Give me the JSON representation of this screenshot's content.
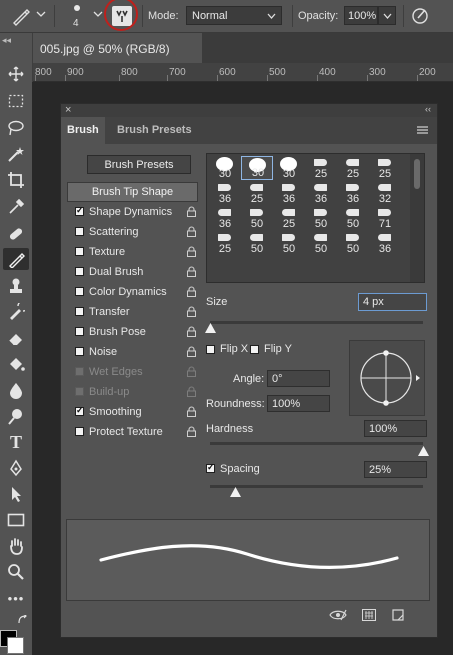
{
  "options_bar": {
    "mode_label": "Mode:",
    "mode_value": "Normal",
    "opacity_label": "Opacity:",
    "opacity_value": "100%",
    "brush_size_preview": "4"
  },
  "document_tab": {
    "title": "005.jpg @ 50% (RGB/8)"
  },
  "ruler": {
    "labels": [
      "800",
      "900",
      "800",
      "700",
      "600",
      "500",
      "400",
      "300",
      "200"
    ]
  },
  "panel": {
    "tabs": [
      "Brush",
      "Brush Presets"
    ],
    "presets_button": "Brush Presets",
    "tip_shape_label": "Brush Tip Shape",
    "options": [
      {
        "label": "Shape Dynamics",
        "checked": true,
        "enabled": true
      },
      {
        "label": "Scattering",
        "checked": false,
        "enabled": true
      },
      {
        "label": "Texture",
        "checked": false,
        "enabled": true
      },
      {
        "label": "Dual Brush",
        "checked": false,
        "enabled": true
      },
      {
        "label": "Color Dynamics",
        "checked": false,
        "enabled": true
      },
      {
        "label": "Transfer",
        "checked": false,
        "enabled": true
      },
      {
        "label": "Brush Pose",
        "checked": false,
        "enabled": true
      },
      {
        "label": "Noise",
        "checked": false,
        "enabled": true
      },
      {
        "label": "Wet Edges",
        "checked": false,
        "enabled": false
      },
      {
        "label": "Build-up",
        "checked": false,
        "enabled": false
      },
      {
        "label": "Smoothing",
        "checked": true,
        "enabled": true
      },
      {
        "label": "Protect Texture",
        "checked": false,
        "enabled": true
      }
    ],
    "brush_sizes": [
      [
        "30",
        "30",
        "30",
        "25",
        "25",
        "25"
      ],
      [
        "36",
        "25",
        "36",
        "36",
        "36",
        "32"
      ],
      [
        "36",
        "50",
        "25",
        "50",
        "50",
        "71"
      ],
      [
        "25",
        "50",
        "50",
        "50",
        "50",
        "36"
      ]
    ],
    "size_label": "Size",
    "size_value": "4 px",
    "flip_x": "Flip X",
    "flip_y": "Flip Y",
    "angle_label": "Angle:",
    "angle_value": "0°",
    "roundness_label": "Roundness:",
    "roundness_value": "100%",
    "hardness_label": "Hardness",
    "hardness_value": "100%",
    "spacing_label": "Spacing",
    "spacing_value": "25%",
    "size_slider": 0.0,
    "hardness_slider": 1.0,
    "spacing_slider": 0.12
  }
}
